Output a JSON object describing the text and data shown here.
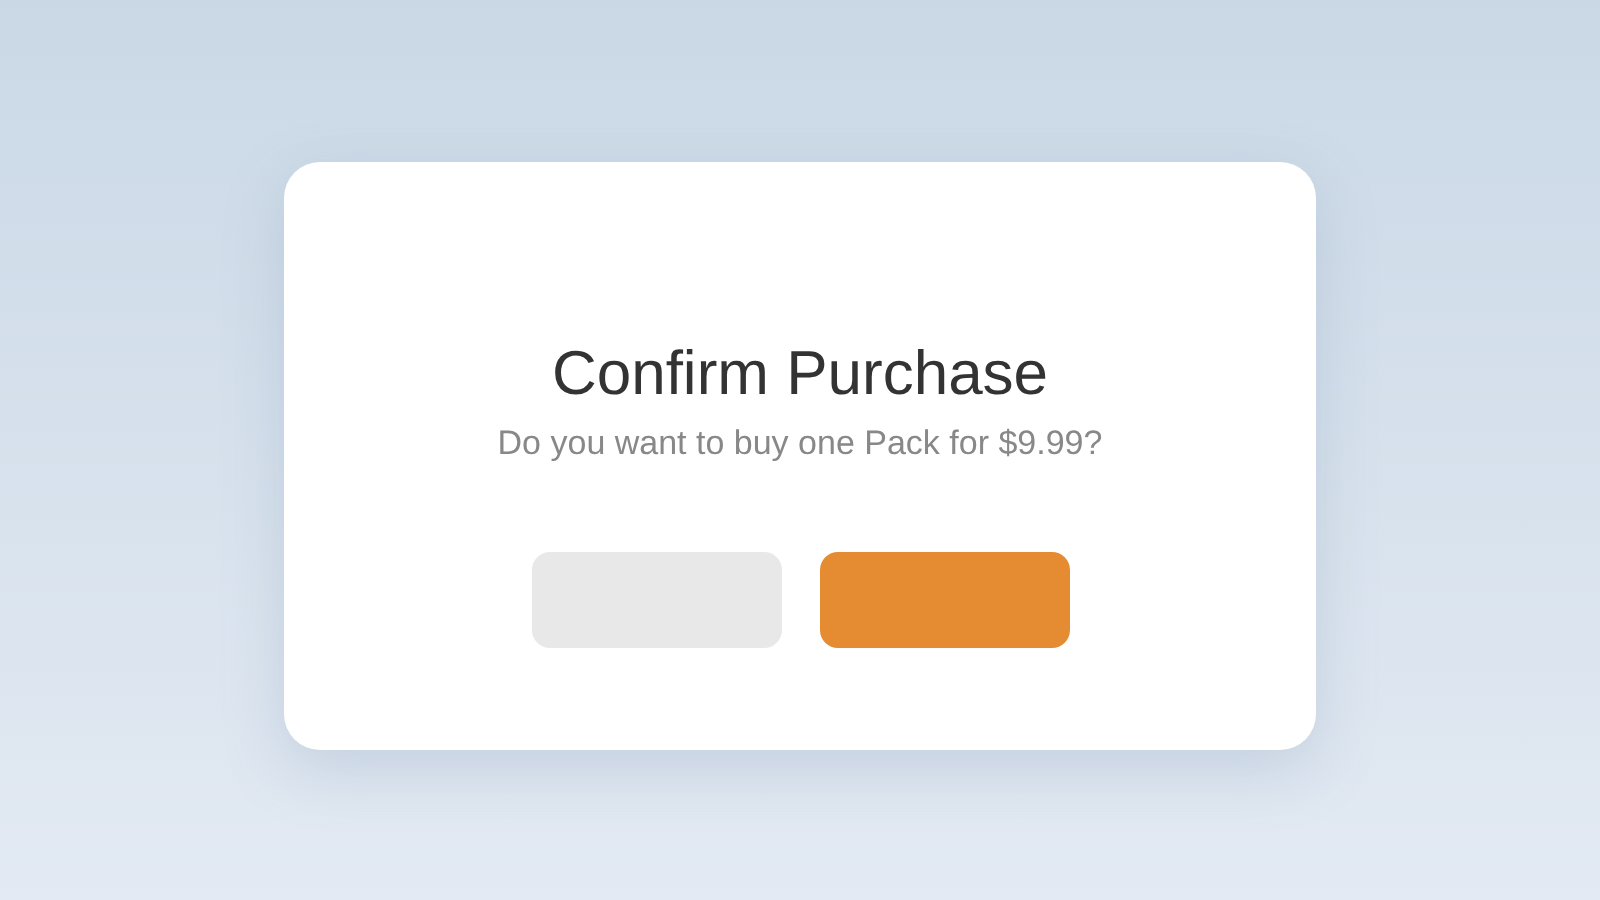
{
  "dialog": {
    "title": "Confirm Purchase",
    "message": "Do you want to buy one Pack for $9.99?",
    "buttons": [
      {
        "kind": "secondary"
      },
      {
        "kind": "primary"
      }
    ]
  }
}
